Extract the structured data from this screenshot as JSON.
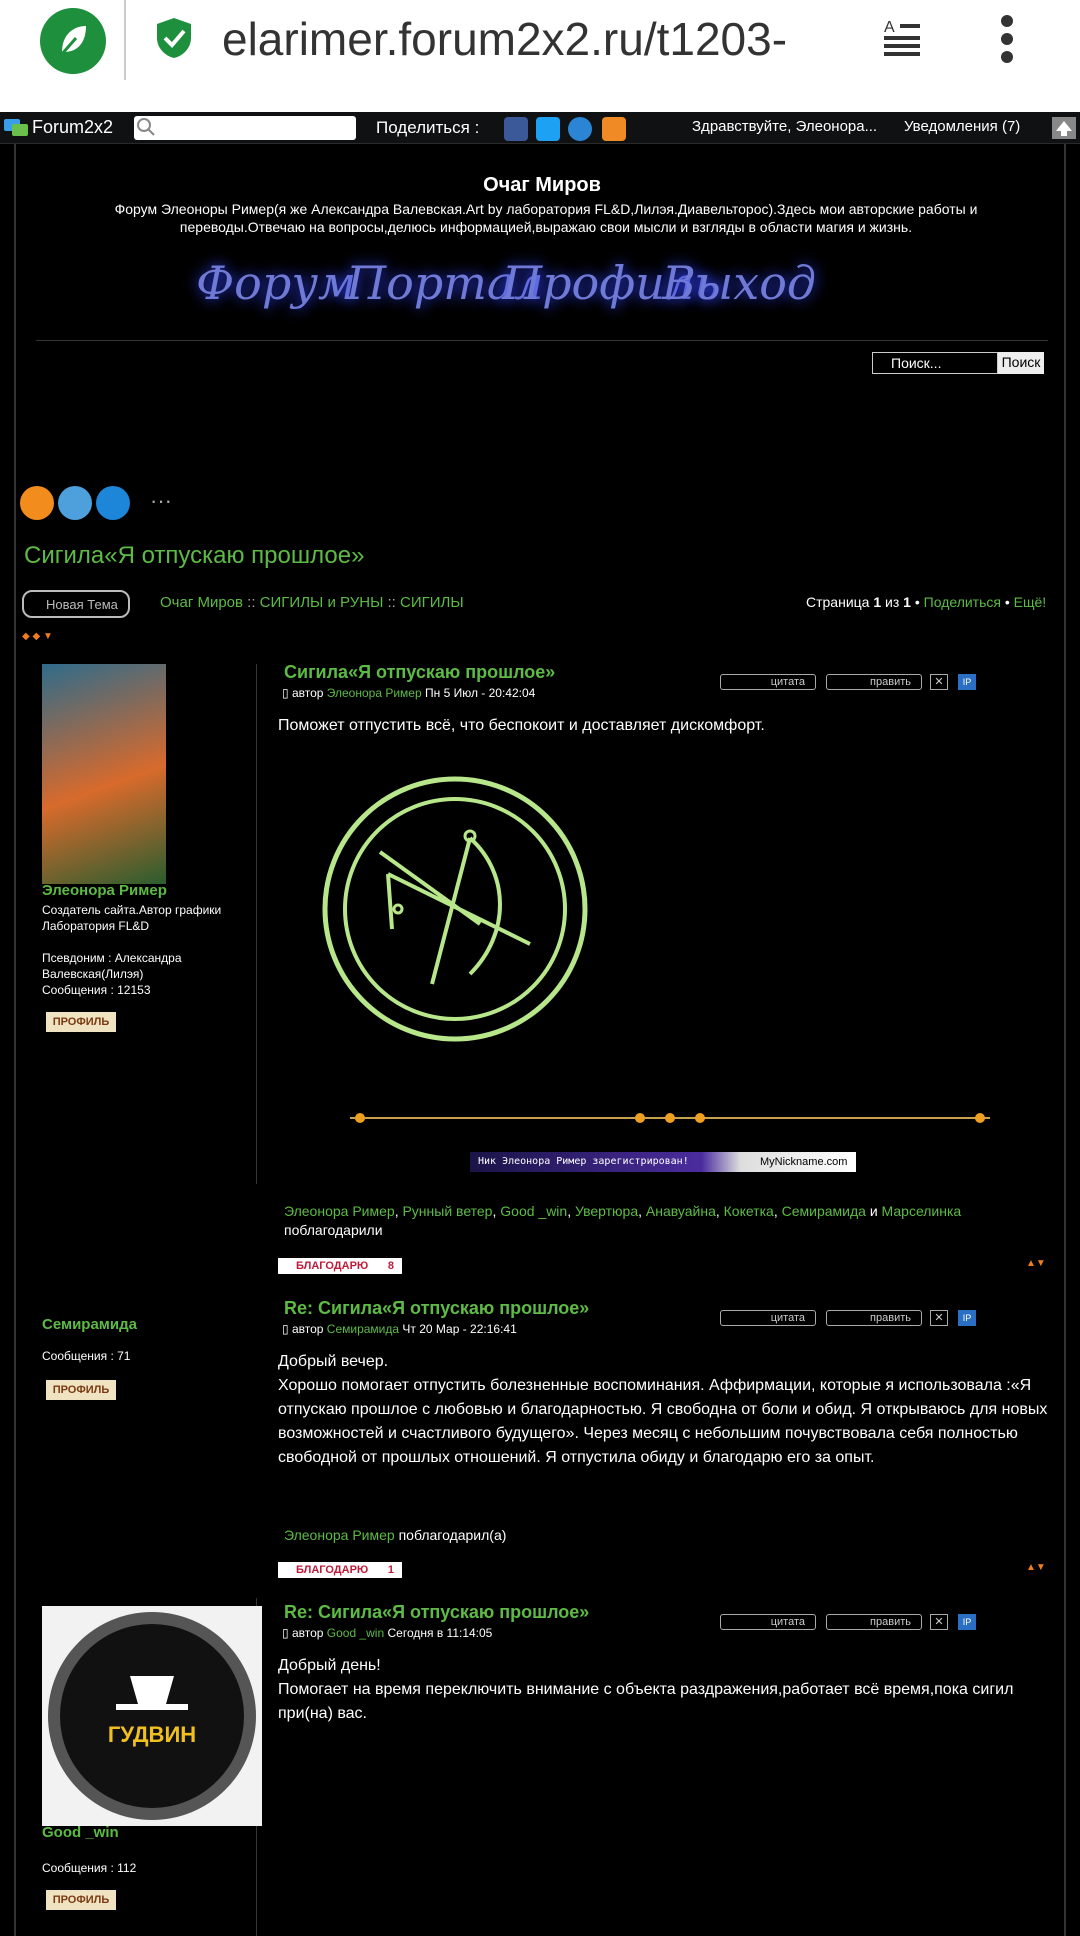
{
  "browser": {
    "url": "elarimer.forum2x2.ru/t1203-"
  },
  "topnav": {
    "logo_text": "Forum2x2",
    "share_label": "Поделиться :",
    "greeting": "Здравствуйте, Элеонора...",
    "notifications": "Уведомления  (7)"
  },
  "header": {
    "title": "Очаг Миров",
    "description": "Форум Элеоноры Ример(я же Александра Валевская.Art by лаборатория FL&D,Лилэя.Диавельторос).Здесь мои авторские работы и переводы.Отвечаю на вопросы,делюсь информацией,выражаю свои мысли и взгляды в области магия и жизнь.",
    "menu": [
      "Форум",
      "Портал",
      "Профиль",
      "Выход"
    ],
    "search_placeholder": "Поиск...",
    "search_button": "Поиск"
  },
  "thread": {
    "title": "Сигила«Я отпускаю прошлое»",
    "new_topic": "Новая Тема",
    "breadcrumb": [
      "Очаг Миров",
      "СИГИЛЫ и РУНЫ",
      "СИГИЛЫ"
    ],
    "page_info": {
      "prefix": "Страница",
      "current": "1",
      "of": "из",
      "total": "1",
      "share": "Поделиться",
      "more": "Ещё!"
    }
  },
  "buttons": {
    "quote": "цитата",
    "edit": "править",
    "thanks": "БЛАГОДАРЮ",
    "profile": "ПРОФИЛЬ",
    "ip": "IP"
  },
  "posts": [
    {
      "title": "Сигила«Я отпускаю прошлое»",
      "meta_prefix": "автор",
      "author": "Элеонора Ример",
      "date": "Пн 5 Июл - 20:42:04",
      "body": "Поможет отпустить всё, что беспокоит и доставляет дискомфорт.",
      "author_name": "Элеонора Ример",
      "author_rank": "Создатель сайта.Автор графики Лаборатория FL&D",
      "author_alias": "Псевдоним : Александра Валевская(Лилэя)",
      "author_posts": "Сообщения : 12153",
      "signature_nick": "Ник Элеонора Ример зарегистрирован!",
      "signature_site": "MyNickname.com",
      "thanks_names": [
        "Элеонора Ример",
        "Рунный ветер",
        "Good _win",
        "Увертюра",
        "Анавуайна",
        "Кокетка",
        "Семирамида"
      ],
      "thanks_last": "Марселинка",
      "thanks_suffix": "поблагодарили",
      "thanks_count": "8"
    },
    {
      "title": "Re: Сигила«Я отпускаю прошлое»",
      "meta_prefix": "автор",
      "author": "Семирамида",
      "date": "Чт 20 Мар - 22:16:41",
      "body_lines": [
        "Добрый вечер.",
        "Хорошо помогает отпустить болезненные воспоминания. Аффирмации, которые я использовала :«Я отпускаю прошлое с любовью и благодарностью. Я свободна от боли и обид. Я открываюсь для новых возможностей и счастливого будущего». Через месяц с небольшим почувствовала себя полностью свободной от прошлых отношений. Я отпустила обиду и благодарю его за опыт."
      ],
      "author_name": "Семирамида",
      "author_posts": "Сообщения : 71",
      "thanks_name": "Элеонора Ример",
      "thanks_suffix": "поблагодарил(а)",
      "thanks_count": "1"
    },
    {
      "title": "Re: Сигила«Я отпускаю прошлое»",
      "meta_prefix": "автор",
      "author": "Good _win",
      "date": "Сегодня в 11:14:05",
      "body_lines": [
        "Добрый день!",
        "Помогает на время переключить внимание с объекта раздражения,работает всё время,пока сигил при(на) вас."
      ],
      "author_name": "Good _win",
      "avatar_text": "ГУДВИН",
      "author_posts": "Сообщения : 112"
    }
  ],
  "colors": {
    "accent_green": "#5dbb45",
    "link_blue_glow": "#6f7ad6",
    "sigil_green": "#b8e68a",
    "thanks_red": "#c01a3a"
  }
}
